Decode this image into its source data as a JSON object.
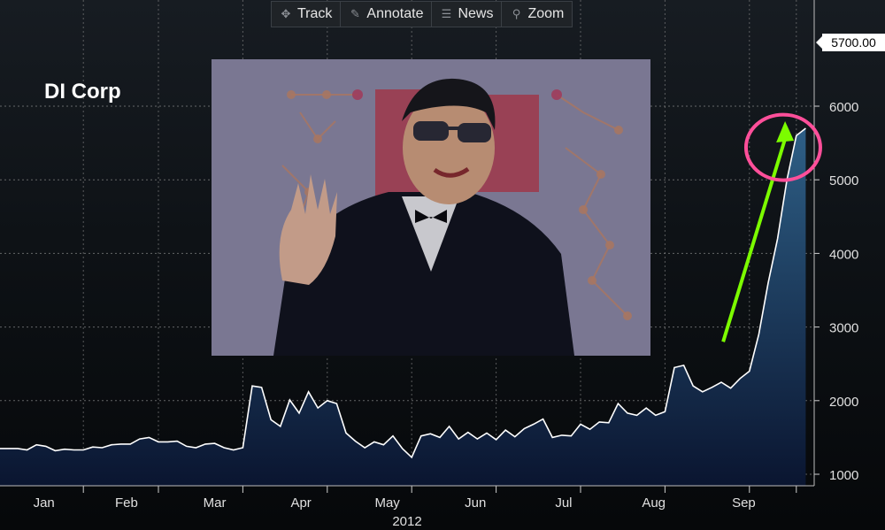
{
  "toolbar": {
    "track": {
      "label": "Track",
      "icon": "crosshair-icon"
    },
    "annotate": {
      "label": "Annotate",
      "icon": "pencil-icon"
    },
    "news": {
      "label": "News",
      "icon": "news-icon"
    },
    "zoom": {
      "label": "Zoom",
      "icon": "magnifier-icon"
    }
  },
  "last_price_label": "5700.00",
  "colors": {
    "line": "#ffffff",
    "area_top": "#2e5f86",
    "area_bottom": "#0a1530",
    "grid": "#8a8a8a",
    "highlight_circle": "#ff4f9a",
    "trend_arrow": "#7cfc00"
  },
  "chart_data": {
    "type": "area",
    "title": "DI Corp",
    "year_label": "2012",
    "x_tick_labels": [
      "Jan",
      "Feb",
      "Mar",
      "Apr",
      "May",
      "Jun",
      "Jul",
      "Aug",
      "Sep"
    ],
    "y_ticks": [
      1000,
      2000,
      3000,
      4000,
      5000,
      6000
    ],
    "ylim": [
      850,
      6200
    ],
    "grid": true,
    "axis_position": "right",
    "x_unit": "week of 2012",
    "series": [
      {
        "x": [
          0,
          0.5,
          1,
          1.5,
          2,
          2.5,
          3,
          3.5,
          4,
          4.5,
          5,
          5.5,
          6,
          6.5,
          7,
          7.5,
          8,
          8.5,
          9,
          9.5,
          10,
          10.5,
          11,
          11.5,
          12,
          12.5,
          13,
          13.5,
          14,
          14.5,
          15,
          15.5,
          16,
          16.5,
          17,
          17.5,
          18,
          18.5,
          19,
          19.5,
          20,
          20.5,
          21,
          21.5,
          22,
          22.5,
          23,
          23.5,
          24,
          24.5,
          25,
          25.5,
          26,
          26.5,
          27,
          27.5,
          28,
          28.5,
          29,
          29.5,
          30,
          30.5,
          31,
          31.5,
          32,
          32.5,
          33,
          33.5,
          34,
          34.5,
          35,
          35.5,
          36,
          36.5,
          37,
          37.5,
          38,
          38.5,
          39,
          39.5,
          40,
          40.5,
          41,
          41.5,
          42
        ],
        "values": [
          1350,
          1330,
          1400,
          1380,
          1320,
          1340,
          1330,
          1330,
          1370,
          1360,
          1400,
          1410,
          1410,
          1480,
          1500,
          1440,
          1440,
          1450,
          1380,
          1360,
          1410,
          1420,
          1360,
          1330,
          1360,
          2200,
          2180,
          1740,
          1650,
          2010,
          1830,
          2120,
          1900,
          2000,
          1960,
          1560,
          1450,
          1360,
          1440,
          1400,
          1520,
          1350,
          1230,
          1520,
          1550,
          1500,
          1650,
          1480,
          1570,
          1480,
          1560,
          1470,
          1600,
          1510,
          1620,
          1680,
          1750,
          1500,
          1530,
          1520,
          1680,
          1610,
          1710,
          1700,
          1960,
          1830,
          1800,
          1900,
          1800,
          1850,
          2450,
          2480,
          2200,
          2120,
          2180,
          2250,
          2170,
          2300,
          2400,
          2900,
          3600,
          4200,
          5000,
          5600,
          5700
        ]
      }
    ],
    "trend_annotation": {
      "from": {
        "x": 37.6,
        "y": 2800
      },
      "to": {
        "x": 40.9,
        "y": 5700
      }
    },
    "highlight_annotation": {
      "x": 40.8,
      "y": 5500
    }
  }
}
